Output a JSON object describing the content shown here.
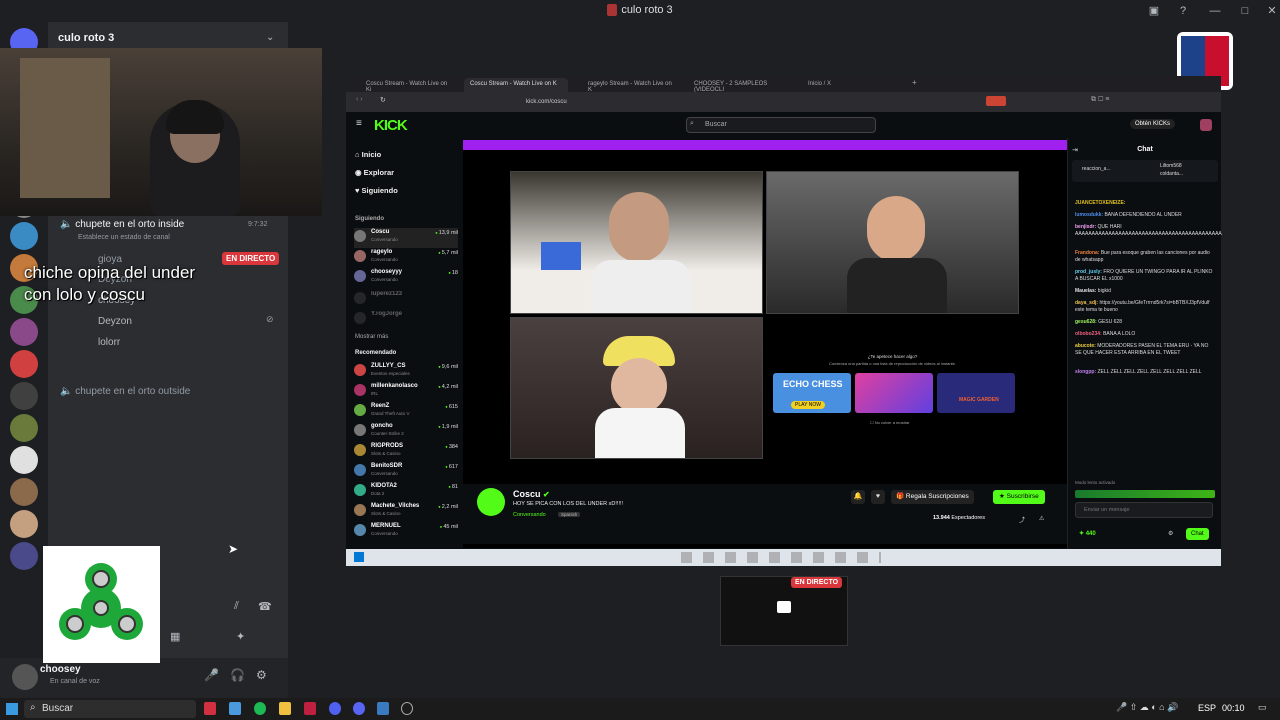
{
  "window": {
    "title": "culo roto 3"
  },
  "server": {
    "name": "culo roto 3"
  },
  "voice": {
    "channel_inside": "chupete en el orto inside",
    "channel_inside_time": "9:7:32",
    "status_hint": "Establece un estado de canal",
    "users": [
      "gioya",
      "Deyzon",
      "choosey",
      "Deyzon",
      "lolorr"
    ],
    "live_badge": "EN DIRECTO",
    "channel_outside": "chupete en el orto outside"
  },
  "caption": "chiche opina del under con lolo y coscu",
  "user_panel": {
    "name": "choosey",
    "status": "En canal de voz"
  },
  "taskbar": {
    "search": "Buscar",
    "lang": "ESP",
    "clock": "00:10"
  },
  "browser": {
    "tabs": [
      "Coscu Stream - Watch Live on Ki",
      "Coscu Stream - Watch Live on K",
      "rageylo Stream - Watch Live on K",
      "CHOOSEY - 2 SAMPLEOS (VIDEOCLI",
      "Inicio / X"
    ],
    "url": "kick.com/coscu"
  },
  "kick": {
    "search_placeholder": "Buscar",
    "get_kicks": "Obtén KICKs",
    "nav": [
      "Inicio",
      "Explorar",
      "Siguiendo"
    ],
    "following_label": "Siguiendo",
    "following": [
      {
        "name": "Coscu",
        "sub": "Conversando",
        "viewers": "13,9 mil"
      },
      {
        "name": "rageylo",
        "sub": "Conversando",
        "viewers": "5,7 mil"
      },
      {
        "name": "chooseyyy",
        "sub": "Conversando",
        "viewers": "18"
      },
      {
        "name": "luperez123",
        "sub": "",
        "viewers": ""
      },
      {
        "name": "Y.rogJorge",
        "sub": "",
        "viewers": ""
      }
    ],
    "show_more": "Mostrar más",
    "recommended_label": "Recomendado",
    "recommended": [
      {
        "name": "ZULLYY_CS",
        "sub": "Eventos especiales",
        "viewers": "9,6 mil"
      },
      {
        "name": "millenkanolasco",
        "sub": "IRL",
        "viewers": "4,2 mil"
      },
      {
        "name": "ReenZ",
        "sub": "Grand Theft Auto V",
        "viewers": "615"
      },
      {
        "name": "goncho",
        "sub": "Counter-Strike 2",
        "viewers": "1,9 mil"
      },
      {
        "name": "RIGPRODS",
        "sub": "Slots & Casino",
        "viewers": "384"
      },
      {
        "name": "BenitoSDR",
        "sub": "Conversando",
        "viewers": "617"
      },
      {
        "name": "KIDOTA2",
        "sub": "Dota 2",
        "viewers": "81"
      },
      {
        "name": "Machete_Vilches",
        "sub": "Slots & Casino",
        "viewers": "2,2 mil"
      },
      {
        "name": "MERNUEL",
        "sub": "Conversando",
        "viewers": "45 mil"
      }
    ],
    "games_prompt": "¿Te apetece hacer algo?",
    "games_sub": "Comienza una partida o una lista de reproducción de videos al instante.",
    "game_labels": [
      "ECHO CHESS",
      "PLAY NOW",
      "MAGIC GARDEN"
    ],
    "dont_show": "No volver a mostrar",
    "streamer": "Coscu",
    "stream_title": "HOY SE PICA CON LOS DEL UNDER xD!!!!!",
    "category": "Conversando",
    "language": "Spanish",
    "gift_subs": "Regala Suscripciones",
    "subscribe": "Suscribirse",
    "viewers": "13.944",
    "viewers_label": "Espectadores"
  },
  "chat": {
    "title": "Chat",
    "pinned": "reaccion_a...",
    "pinned_users": [
      "Liltom568",
      "coldanta..."
    ],
    "messages": [
      {
        "user": "JUANCETOXENEIZE:",
        "text": ""
      },
      {
        "user": "lumosdukk:",
        "text": "BANA DEFENDIENDO AL UNDER"
      },
      {
        "user": "benjisdr:",
        "text": "QUE HARI AAAAAAAAAAAAAAAAAAAAAAAAAAAAAAAAAAAAAAAAAAAAAAAAAAAAAAAAAAAAAAAAAAAAAAAAAAAAAAAAAAAAAAAAAAAA"
      },
      {
        "user": "Frandona:",
        "text": "Bue para esoque graben las canciones por audio de whatsapp"
      },
      {
        "user": "prod_jusly:",
        "text": "FRO QUIERE UN TWINGO PARA IR AL PLINKO A BUSCAR EL x1000"
      },
      {
        "user": "Mauelas:",
        "text": "bigkid"
      },
      {
        "user": "daya_sdj:",
        "text": "https://youtu.be/GfeTrrrnd5rk7si=bBTBXJ3pfVdulf este tema te bueno"
      },
      {
        "user": "gesu628:",
        "text": "GESU 628"
      },
      {
        "user": "olbobo234:",
        "text": "BANA A LOLO"
      },
      {
        "user": "abucote:",
        "text": "MODERADORES PASEN EL TEMA ERU - YA NO SE QUE HACER ESTA ARRIBA EN EL TWEET"
      },
      {
        "user": "slongpp:",
        "text": "ZELL ZELL ZELL ZELL ZELL ZELL ZELL ZELL"
      }
    ],
    "mode": "Modo lento activado",
    "input_placeholder": "Enviar un mensaje",
    "kicks": "440",
    "send": "Chat"
  },
  "preview_badge": "EN DIRECTO"
}
